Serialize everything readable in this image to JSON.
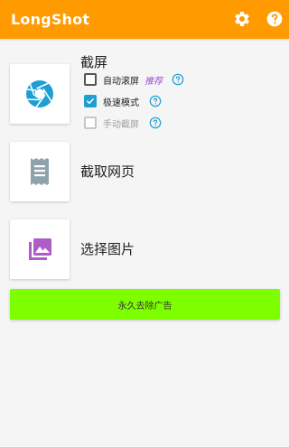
{
  "app": {
    "title": "LongShot",
    "bar_color": "#ff9a00",
    "settings_icon": "gear-icon",
    "help_icon": "help-circle-icon"
  },
  "screenshot": {
    "title": "截屏",
    "tile_icon": "camera-shutter-icon",
    "tile_color": "#1e9ed3",
    "options": [
      {
        "label": "自动滚屏",
        "tag": "推荐",
        "checked": false,
        "disabled": false
      },
      {
        "label": "极速模式",
        "tag": "",
        "checked": true,
        "disabled": false
      },
      {
        "label": "手动截屏",
        "tag": "",
        "checked": false,
        "disabled": true
      }
    ]
  },
  "webpage": {
    "title": "截取网页",
    "tile_icon": "receipt-icon",
    "tile_color": "#8fa3ad"
  },
  "images": {
    "title": "选择图片",
    "tile_icon": "photo-library-icon",
    "tile_color": "#b05cc8"
  },
  "remove_ads": {
    "label": "永久去除广告",
    "color": "#7dff00"
  }
}
